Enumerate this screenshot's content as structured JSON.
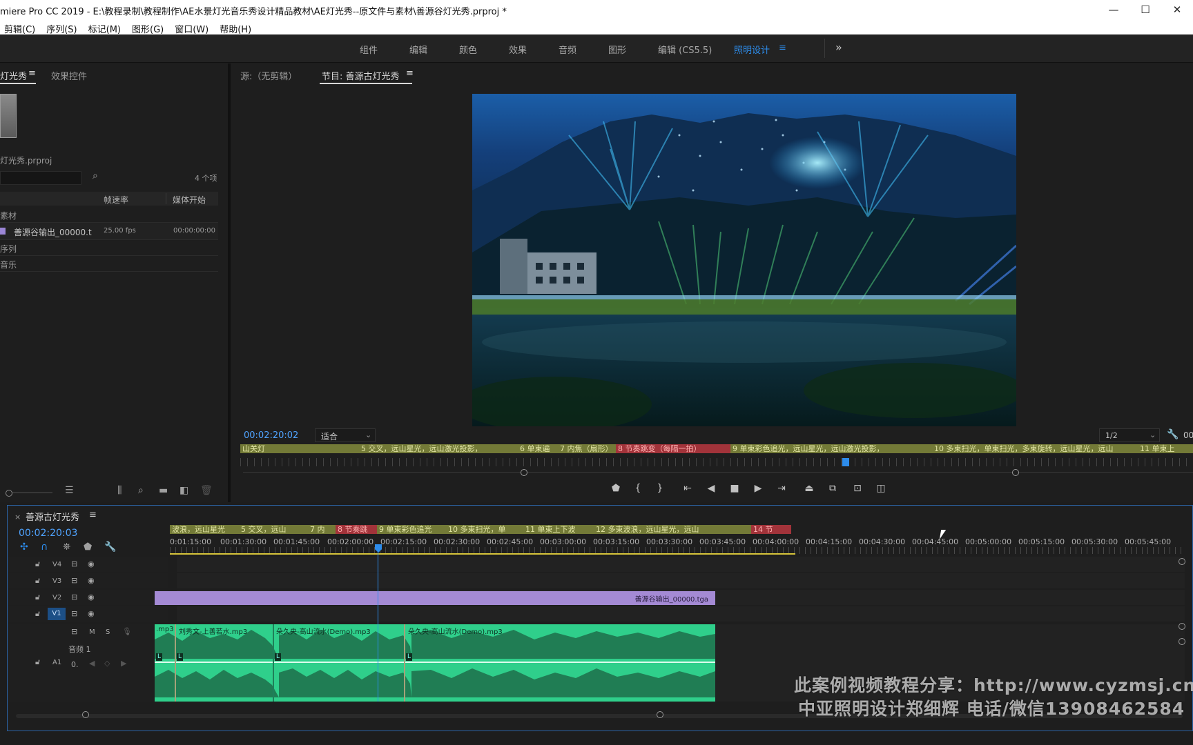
{
  "app": {
    "title": "miere Pro CC 2019 - E:\\教程录制\\教程制作\\AE水景灯光音乐秀设计精品教材\\AE灯光秀--原文件与素材\\善源谷灯光秀.prproj *"
  },
  "window_controls": {
    "minimize": "—",
    "maximize": "☐",
    "close": "✕"
  },
  "menu": [
    "剪辑(C)",
    "序列(S)",
    "标记(M)",
    "图形(G)",
    "窗口(W)",
    "帮助(H)"
  ],
  "workspaces": {
    "items": [
      "组件",
      "编辑",
      "颜色",
      "效果",
      "音频",
      "图形",
      "编辑 (CS5.5)",
      "照明设计"
    ],
    "active": "照明设计",
    "overflow": "»"
  },
  "project_panel": {
    "tab_active": "灯光秀",
    "tab_other": "效果控件",
    "project_file": "灯光秀.prproj",
    "item_count": "4 个项",
    "columns": [
      "帧速率",
      "媒体开始"
    ],
    "rows": [
      {
        "name": "素材",
        "fps": "",
        "start": ""
      },
      {
        "name": "善源谷输出_00000.t",
        "fps": "25.00 fps",
        "start": "00:00:00:00"
      },
      {
        "name": "序列",
        "fps": "",
        "start": ""
      },
      {
        "name": "音乐",
        "fps": "",
        "start": ""
      }
    ]
  },
  "source_monitor": {
    "tab": "源:（无剪辑）"
  },
  "program_monitor": {
    "tab": "节目: 善源古灯光秀",
    "timecode": "00:02:20:02",
    "fit": "适合",
    "resolution": "1/2",
    "right_timecode": "00",
    "markers": [
      {
        "text": "山关灯",
        "color": "g"
      },
      {
        "text": "5 交叉，远山星光，远山激光投影，",
        "color": "g"
      },
      {
        "text": "6 单束遍",
        "color": "g"
      },
      {
        "text": "7 内焦（扇形）",
        "color": "g"
      },
      {
        "text": "8 节奏跳变（每隔一拍）",
        "color": "r"
      },
      {
        "text": "9 单束彩色追光，远山星光，远山激光投影，",
        "color": "g"
      },
      {
        "text": "10 多束扫光，单束扫光，多束旋转，远山星光，远山",
        "color": "g"
      },
      {
        "text": "11 单束上",
        "color": "g"
      }
    ]
  },
  "timeline": {
    "sequence_name": "善源古灯光秀",
    "timecode": "00:02:20:03",
    "ruler": [
      "0:01:15:00",
      "00:01:30:00",
      "00:01:45:00",
      "00:02:00:00",
      "00:02:15:00",
      "00:02:30:00",
      "00:02:45:00",
      "00:03:00:00",
      "00:03:15:00",
      "00:03:30:00",
      "00:03:45:00",
      "00:04:00:00",
      "00:04:15:00",
      "00:04:30:00",
      "00:04:45:00",
      "00:05:00:00",
      "00:05:15:00",
      "00:05:30:00",
      "00:05:45:00"
    ],
    "markers": [
      {
        "text": "波浪，远山星光",
        "color": "g"
      },
      {
        "text": "5 交叉，远山",
        "color": "g"
      },
      {
        "text": "7 内",
        "color": "g"
      },
      {
        "text": "8 节奏跳",
        "color": "r"
      },
      {
        "text": "9 单束彩色追光",
        "color": "g"
      },
      {
        "text": "10 多束扫光，单",
        "color": "g"
      },
      {
        "text": "11 单束上下波",
        "color": "g"
      },
      {
        "text": "12 多束波浪，远山星光，远山",
        "color": "g"
      },
      {
        "text": "14 节",
        "color": "r"
      }
    ],
    "video_tracks": [
      "V4",
      "V3",
      "V2",
      "V1"
    ],
    "audio_track": {
      "name": "A1",
      "label": "音频 1",
      "m": "M",
      "s": "S",
      "volume": "0."
    },
    "video_clip": "善源谷输出_00000.tga",
    "audio_clips": [
      ".mp3",
      "刘秀文-上善若水.mp3",
      "朵久央-高山流水(Demo).mp3",
      "朵久央-高山流水(Demo).mp3"
    ],
    "clip_tag": "L"
  },
  "watermark": {
    "line1": "此案例视频教程分享：http://www.cyzmsj.cn",
    "line2": "中亚照明设计郑细辉 电话/微信13908462584"
  },
  "colors": {
    "accent": "#2d8ceb",
    "marker_green": "#737a37",
    "marker_red": "#a2333a",
    "clip_audio": "#2fcf8b",
    "clip_video": "#a48ad4",
    "timecode": "#4fa3ff"
  }
}
